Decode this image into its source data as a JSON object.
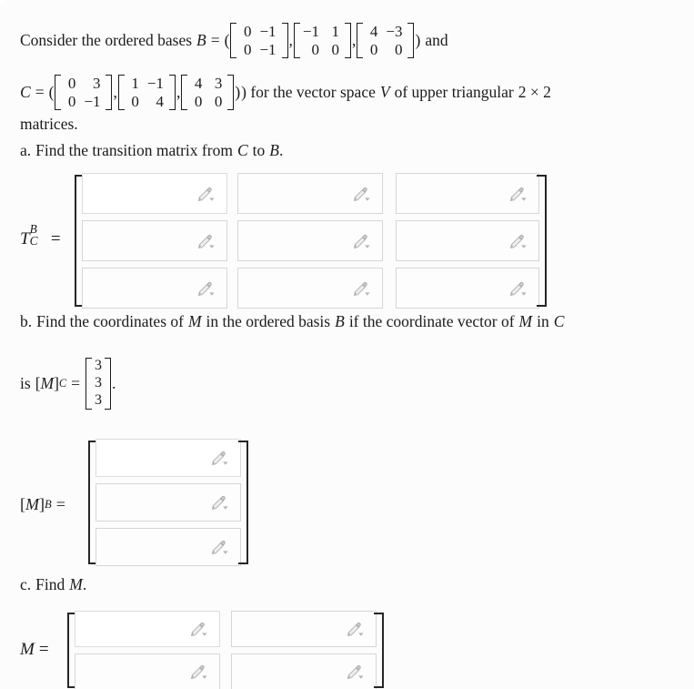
{
  "problem": {
    "intro_prefix": "Consider the ordered bases",
    "basis_B_name": "B",
    "equals": "=",
    "and_word": "and",
    "basis_C_name": "C",
    "tail_text": ") for the vector space",
    "space_name": "V",
    "tail_text2": "of upper triangular",
    "dimension": "2 × 2",
    "matrices_word": "matrices.",
    "open_paren": "(",
    "close_paren": ")",
    "comma": ","
  },
  "basis_B": {
    "label": "B",
    "matrices": [
      {
        "rows": [
          [
            "0",
            "−1"
          ],
          [
            "0",
            "−1"
          ]
        ]
      },
      {
        "rows": [
          [
            "−1",
            "1"
          ],
          [
            "0",
            "0"
          ]
        ]
      },
      {
        "rows": [
          [
            "4",
            "−3"
          ],
          [
            "0",
            "0"
          ]
        ]
      }
    ]
  },
  "basis_C": {
    "label": "C",
    "matrices": [
      {
        "rows": [
          [
            "0",
            "3"
          ],
          [
            "0",
            "−1"
          ]
        ]
      },
      {
        "rows": [
          [
            "1",
            "−1"
          ],
          [
            "0",
            "4"
          ]
        ]
      },
      {
        "rows": [
          [
            "4",
            "3"
          ],
          [
            "0",
            "0"
          ]
        ]
      }
    ]
  },
  "part_a": {
    "label": "a.",
    "text": "Find the transition matrix from",
    "from_basis": "C",
    "to_word": "to",
    "to_basis": "B",
    "period": ".",
    "answer_label": {
      "base": "T",
      "superscript": "B",
      "subscript": "C",
      "equals": "="
    },
    "rows": 3,
    "cols": 3,
    "cells": [
      [
        "",
        "",
        ""
      ],
      [
        "",
        "",
        ""
      ],
      [
        "",
        "",
        ""
      ]
    ],
    "cell_placeholder": "",
    "cell_icon": "pencil-icon"
  },
  "part_b": {
    "label": "b.",
    "text": "Find the coordinates of",
    "m_name": "M",
    "text2": "in the ordered basis",
    "basis": "B",
    "text3": "if the coordinate vector of",
    "m_name2": "M",
    "text4": "in",
    "basis2": "C",
    "given_prefix": "is",
    "given_label": {
      "open_bracket": "[",
      "base": "M",
      "close_bracket": "]",
      "subscript": "C",
      "equals": "="
    },
    "given_vector": [
      "3",
      "3",
      "3"
    ],
    "given_period": ".",
    "answer_label": {
      "open_bracket": "[",
      "base": "M",
      "close_bracket": "]",
      "subscript": "B",
      "equals": "="
    },
    "rows": 3,
    "cols": 1,
    "cells": [
      [
        ""
      ],
      [
        ""
      ],
      [
        ""
      ]
    ],
    "cell_icon": "pencil-icon"
  },
  "part_c": {
    "label": "c.",
    "text": "Find",
    "m_name": "M",
    "period": ".",
    "answer_label": {
      "base": "M",
      "equals": "="
    },
    "rows": 2,
    "cols": 2,
    "cells": [
      [
        "",
        ""
      ],
      [
        "",
        ""
      ]
    ],
    "cell_icon": "pencil-icon"
  },
  "colors": {
    "page_background": "#fcfcfc",
    "text": "#1b1b1b",
    "cell_border": "#d6d6d6",
    "cell_background": "#fdfdfd",
    "bracket": "#262626",
    "icon": "#9a9a9a"
  }
}
